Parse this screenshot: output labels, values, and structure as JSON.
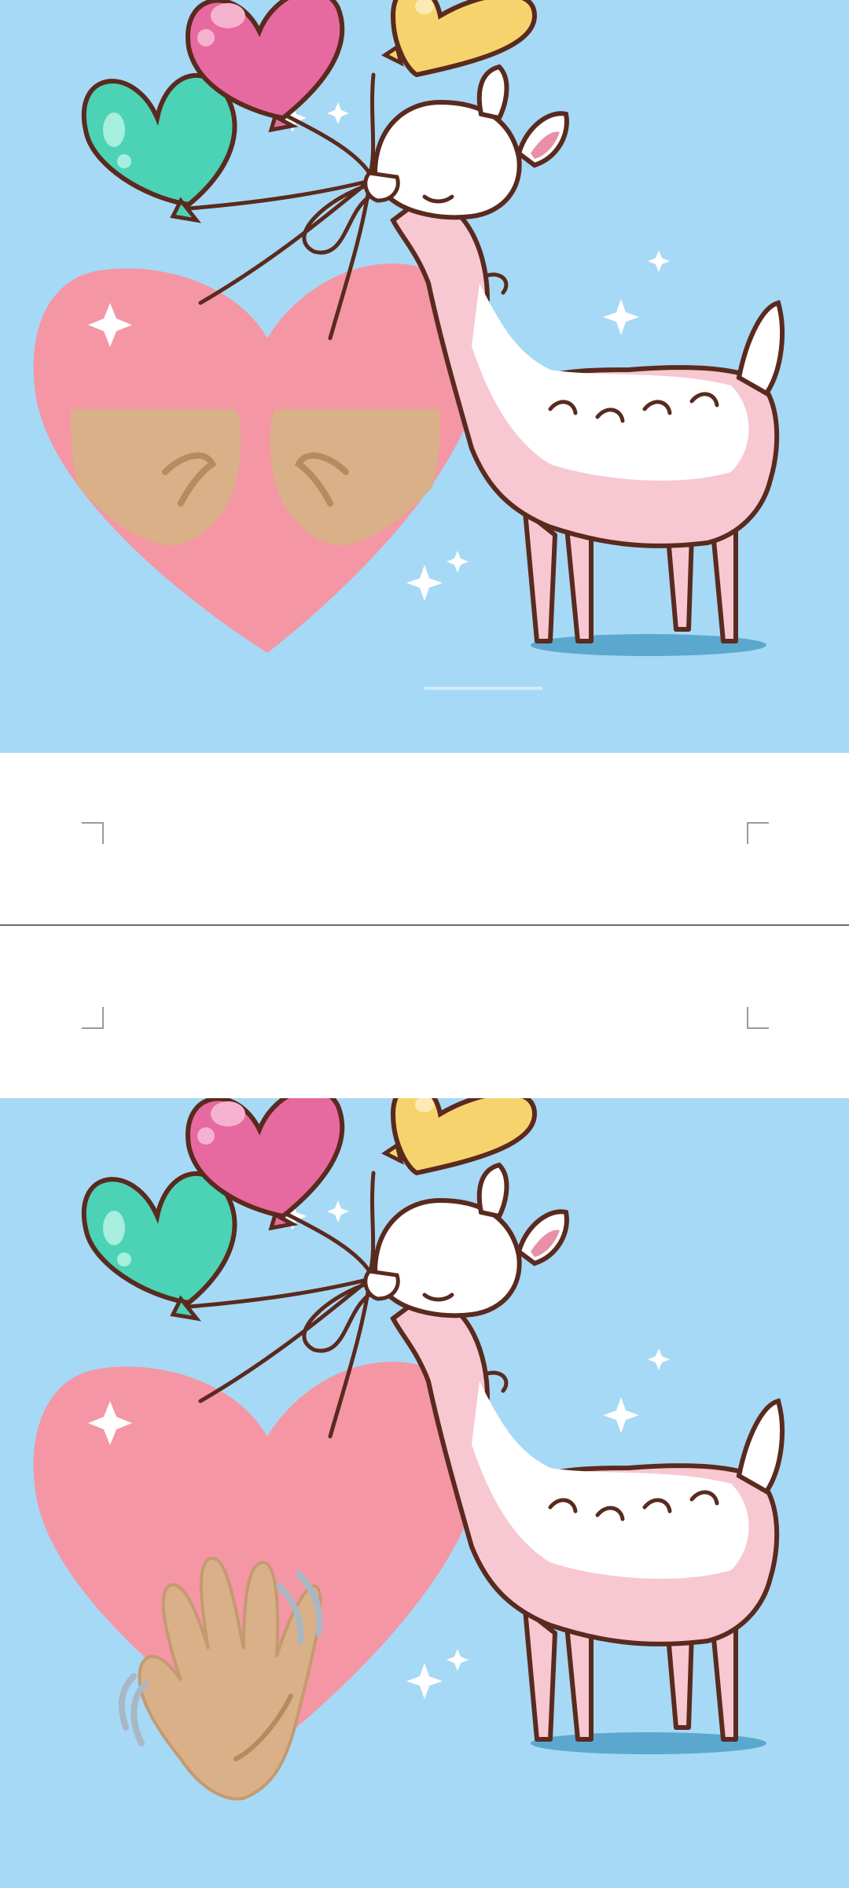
{
  "document": {
    "pages": [
      {
        "image_name": "llama-fist-bump-image"
      },
      {
        "image_name": "llama-wave-image"
      }
    ]
  },
  "colors": {
    "sky": "#a6d9f5",
    "heart": "#f596a4",
    "skin": "#d9b088",
    "balloon_pink": "#e66aa0",
    "balloon_green": "#4cd2b5",
    "balloon_yellow": "#f7d36e",
    "outline": "#5a2a1e"
  }
}
